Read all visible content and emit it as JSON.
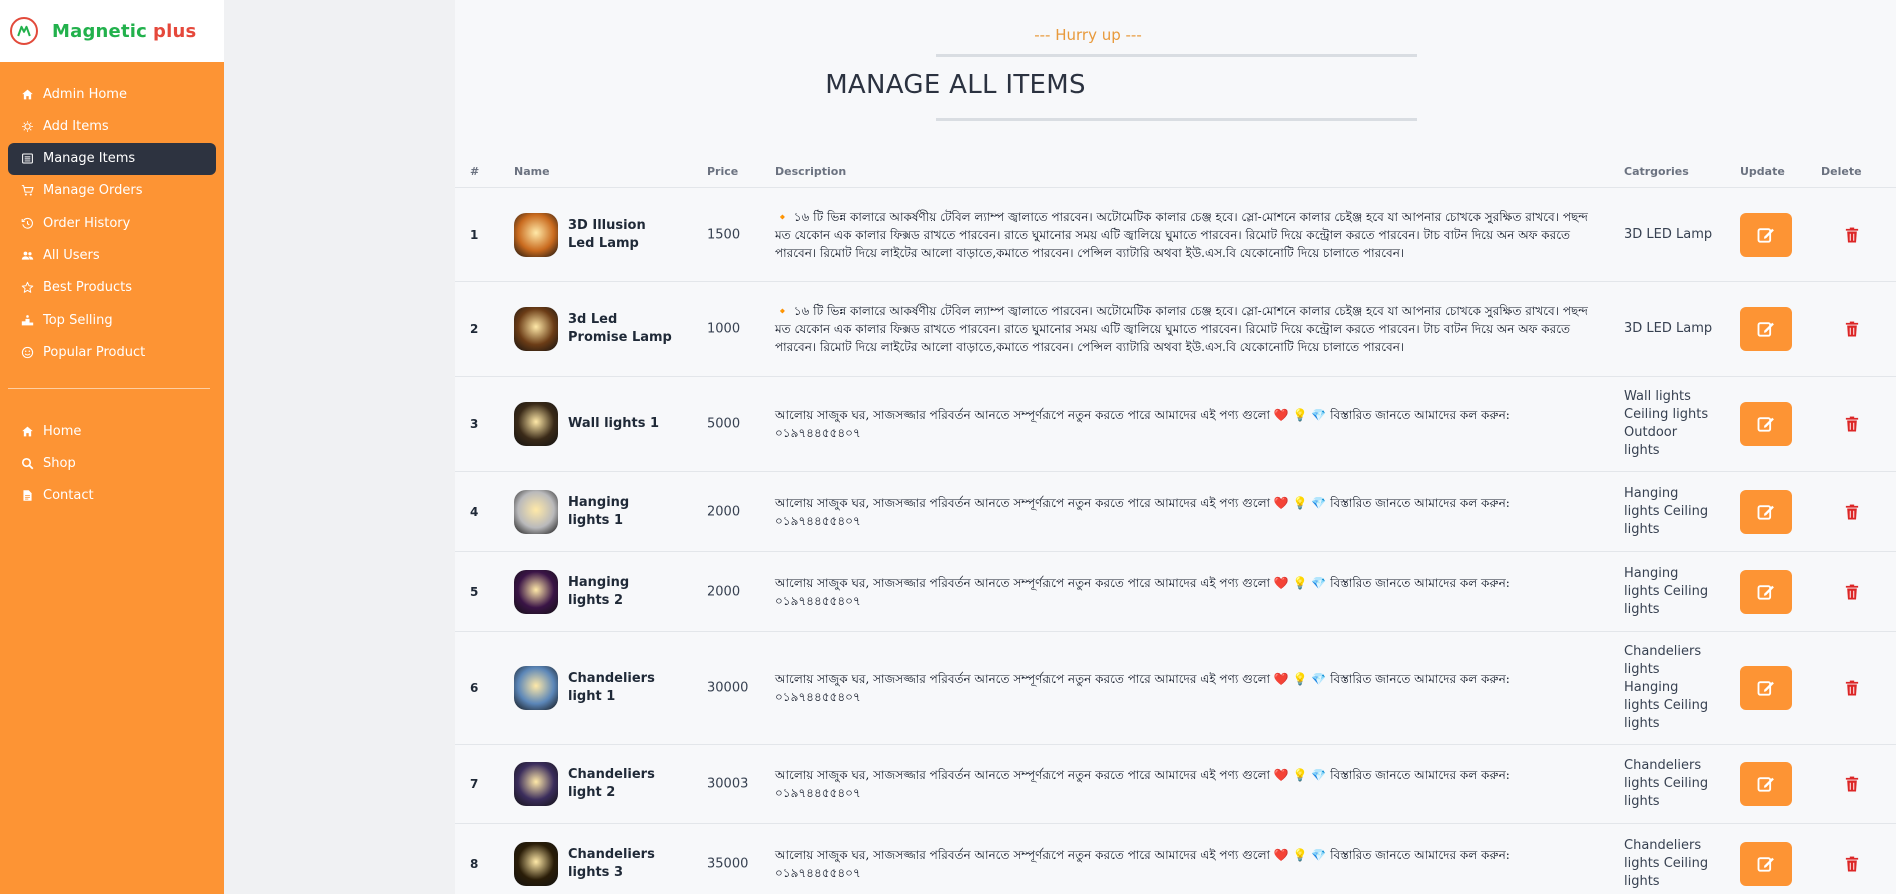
{
  "brand": {
    "name": "Magnetic",
    "plus": "plus"
  },
  "sidebar": {
    "top_items": [
      {
        "label": "Admin Home",
        "icon": "home-icon"
      },
      {
        "label": "Add Items",
        "icon": "bulb-icon"
      },
      {
        "label": "Manage Items",
        "icon": "list-icon",
        "active": true
      },
      {
        "label": "Manage Orders",
        "icon": "cart-icon"
      },
      {
        "label": "Order History",
        "icon": "history-icon"
      },
      {
        "label": "All Users",
        "icon": "users-icon"
      },
      {
        "label": "Best Products",
        "icon": "star-icon"
      },
      {
        "label": "Top Selling",
        "icon": "podium-icon"
      },
      {
        "label": "Popular Product",
        "icon": "smile-icon"
      }
    ],
    "bottom_items": [
      {
        "label": "Home",
        "icon": "home-icon"
      },
      {
        "label": "Shop",
        "icon": "search-icon"
      },
      {
        "label": "Contact",
        "icon": "document-icon"
      }
    ]
  },
  "main": {
    "hurry": "--- Hurry up ---",
    "title": "MANAGE ALL ITEMS"
  },
  "table": {
    "headers": {
      "num": "#",
      "name": "Name",
      "price": "Price",
      "description": "Description",
      "categories": "Catrgories",
      "update": "Update",
      "delete": "Delete"
    },
    "rows": [
      {
        "num": "1",
        "name": "3D Illusion Led Lamp",
        "price": "1500",
        "description": "🔸 ১৬ টি ভিন্ন কালারে আকর্ষণীয় টেবিল ল্যাম্প জ্বালাতে পারবেন। অটোমেটিক কালার চেঞ্জ হবে। স্লো-মোশনে কালার চেইঞ্জ হবে যা আপনার চোখকে সুরক্ষিত রাখবে। পছন্দ মত যেকোন এক কালার ফিক্সড রাখতে পারবেন। রাতে ঘুমানোর সময় এটি জ্বালিয়ে ঘুমাতে পারবেন। রিমোট দিয়ে কন্ট্রোল করতে পারবেন। টাচ বাটন দিয়ে অন অফ করতে পারবেন। রিমোট দিয়ে লাইটের আলো বাড়াতে,কমাতে পারবেন। পেন্সিল ব্যাটারি অথবা ইউ.এস.বি যেকোনোটি দিয়ে চালাতে পারবেন।",
        "categories": "3D LED Lamp",
        "thumb": "#c96a1e"
      },
      {
        "num": "2",
        "name": "3d Led Promise Lamp",
        "price": "1000",
        "description": "🔸 ১৬ টি ভিন্ন কালারে আকর্ষণীয় টেবিল ল্যাম্প জ্বালাতে পারবেন। অটোমেটিক কালার চেঞ্জ হবে। স্লো-মোশনে কালার চেইঞ্জ হবে যা আপনার চোখকে সুরক্ষিত রাখবে। পছন্দ মত যেকোন এক কালার ফিক্সড রাখতে পারবেন। রাতে ঘুমানোর সময় এটি জ্বালিয়ে ঘুমাতে পারবেন। রিমোট দিয়ে কন্ট্রোল করতে পারবেন। টাচ বাটন দিয়ে অন অফ করতে পারবেন। রিমোট দিয়ে লাইটের আলো বাড়াতে,কমাতে পারবেন। পেন্সিল ব্যাটারি অথবা ইউ.এস.বি যেকোনোটি দিয়ে চালাতে পারবেন।",
        "categories": "3D LED Lamp",
        "thumb": "#6b3c16"
      },
      {
        "num": "3",
        "name": "Wall lights 1",
        "price": "5000",
        "description": "আলোয় সাজুক ঘর, সাজসজ্জার পরিবর্তন আনতে সম্পূর্ণরূপে নতুন করতে পারে আমাদের এই পণ্য গুলো ❤️ 💡 💎 বিস্তারিত জানতে আমাদের কল করুন: ০১৯৭৪৪৫৫৪০৭",
        "categories": "Wall lights Ceiling lights Outdoor lights",
        "thumb": "#3a2a18"
      },
      {
        "num": "4",
        "name": "Hanging lights 1",
        "price": "2000",
        "description": "আলোয় সাজুক ঘর, সাজসজ্জার পরিবর্তন আনতে সম্পূর্ণরূপে নতুন করতে পারে আমাদের এই পণ্য গুলো ❤️ 💡 💎 বিস্তারিত জানতে আমাদের কল করুন: ০১৯৭৪৪৫৫৪০৭",
        "categories": "Hanging lights Ceiling lights",
        "thumb": "#b9b9bb"
      },
      {
        "num": "5",
        "name": "Hanging lights 2",
        "price": "2000",
        "description": "আলোয় সাজুক ঘর, সাজসজ্জার পরিবর্তন আনতে সম্পূর্ণরূপে নতুন করতে পারে আমাদের এই পণ্য গুলো ❤️ 💡 💎 বিস্তারিত জানতে আমাদের কল করুন: ০১৯৭৪৪৫৫৪০৭",
        "categories": "Hanging lights Ceiling lights",
        "thumb": "#3a1446"
      },
      {
        "num": "6",
        "name": "Chandeliers light 1",
        "price": "30000",
        "description": "আলোয় সাজুক ঘর, সাজসজ্জার পরিবর্তন আনতে সম্পূর্ণরূপে নতুন করতে পারে আমাদের এই পণ্য গুলো ❤️ 💡 💎 বিস্তারিত জানতে আমাদের কল করুন: ০১৯৭৪৪৫৫৪০৭",
        "categories": "Chandeliers lights Hanging lights Ceiling lights",
        "thumb": "#5b86b8"
      },
      {
        "num": "7",
        "name": "Chandeliers light 2",
        "price": "30003",
        "description": "আলোয় সাজুক ঘর, সাজসজ্জার পরিবর্তন আনতে সম্পূর্ণরূপে নতুন করতে পারে আমাদের এই পণ্য গুলো ❤️ 💡 💎 বিস্তারিত জানতে আমাদের কল করুন: ০১৯৭৪৪৫৫৪০৭",
        "categories": "Chandeliers lights Ceiling lights",
        "thumb": "#3b2d5c"
      },
      {
        "num": "8",
        "name": "Chandeliers lights 3",
        "price": "35000",
        "description": "আলোয় সাজুক ঘর, সাজসজ্জার পরিবর্তন আনতে সম্পূর্ণরূপে নতুন করতে পারে আমাদের এই পণ্য গুলো ❤️ 💡 💎 বিস্তারিত জানতে আমাদের কল করুন: ০১৯৭৪৪৫৫৪০৭",
        "categories": "Chandeliers lights Ceiling lights",
        "thumb": "#2a1d08"
      }
    ]
  },
  "colors": {
    "accent": "#fd9434",
    "active_nav": "#2d3340",
    "delete": "#dc2626",
    "brand_green": "#22b14c",
    "brand_red": "#e5483b"
  }
}
